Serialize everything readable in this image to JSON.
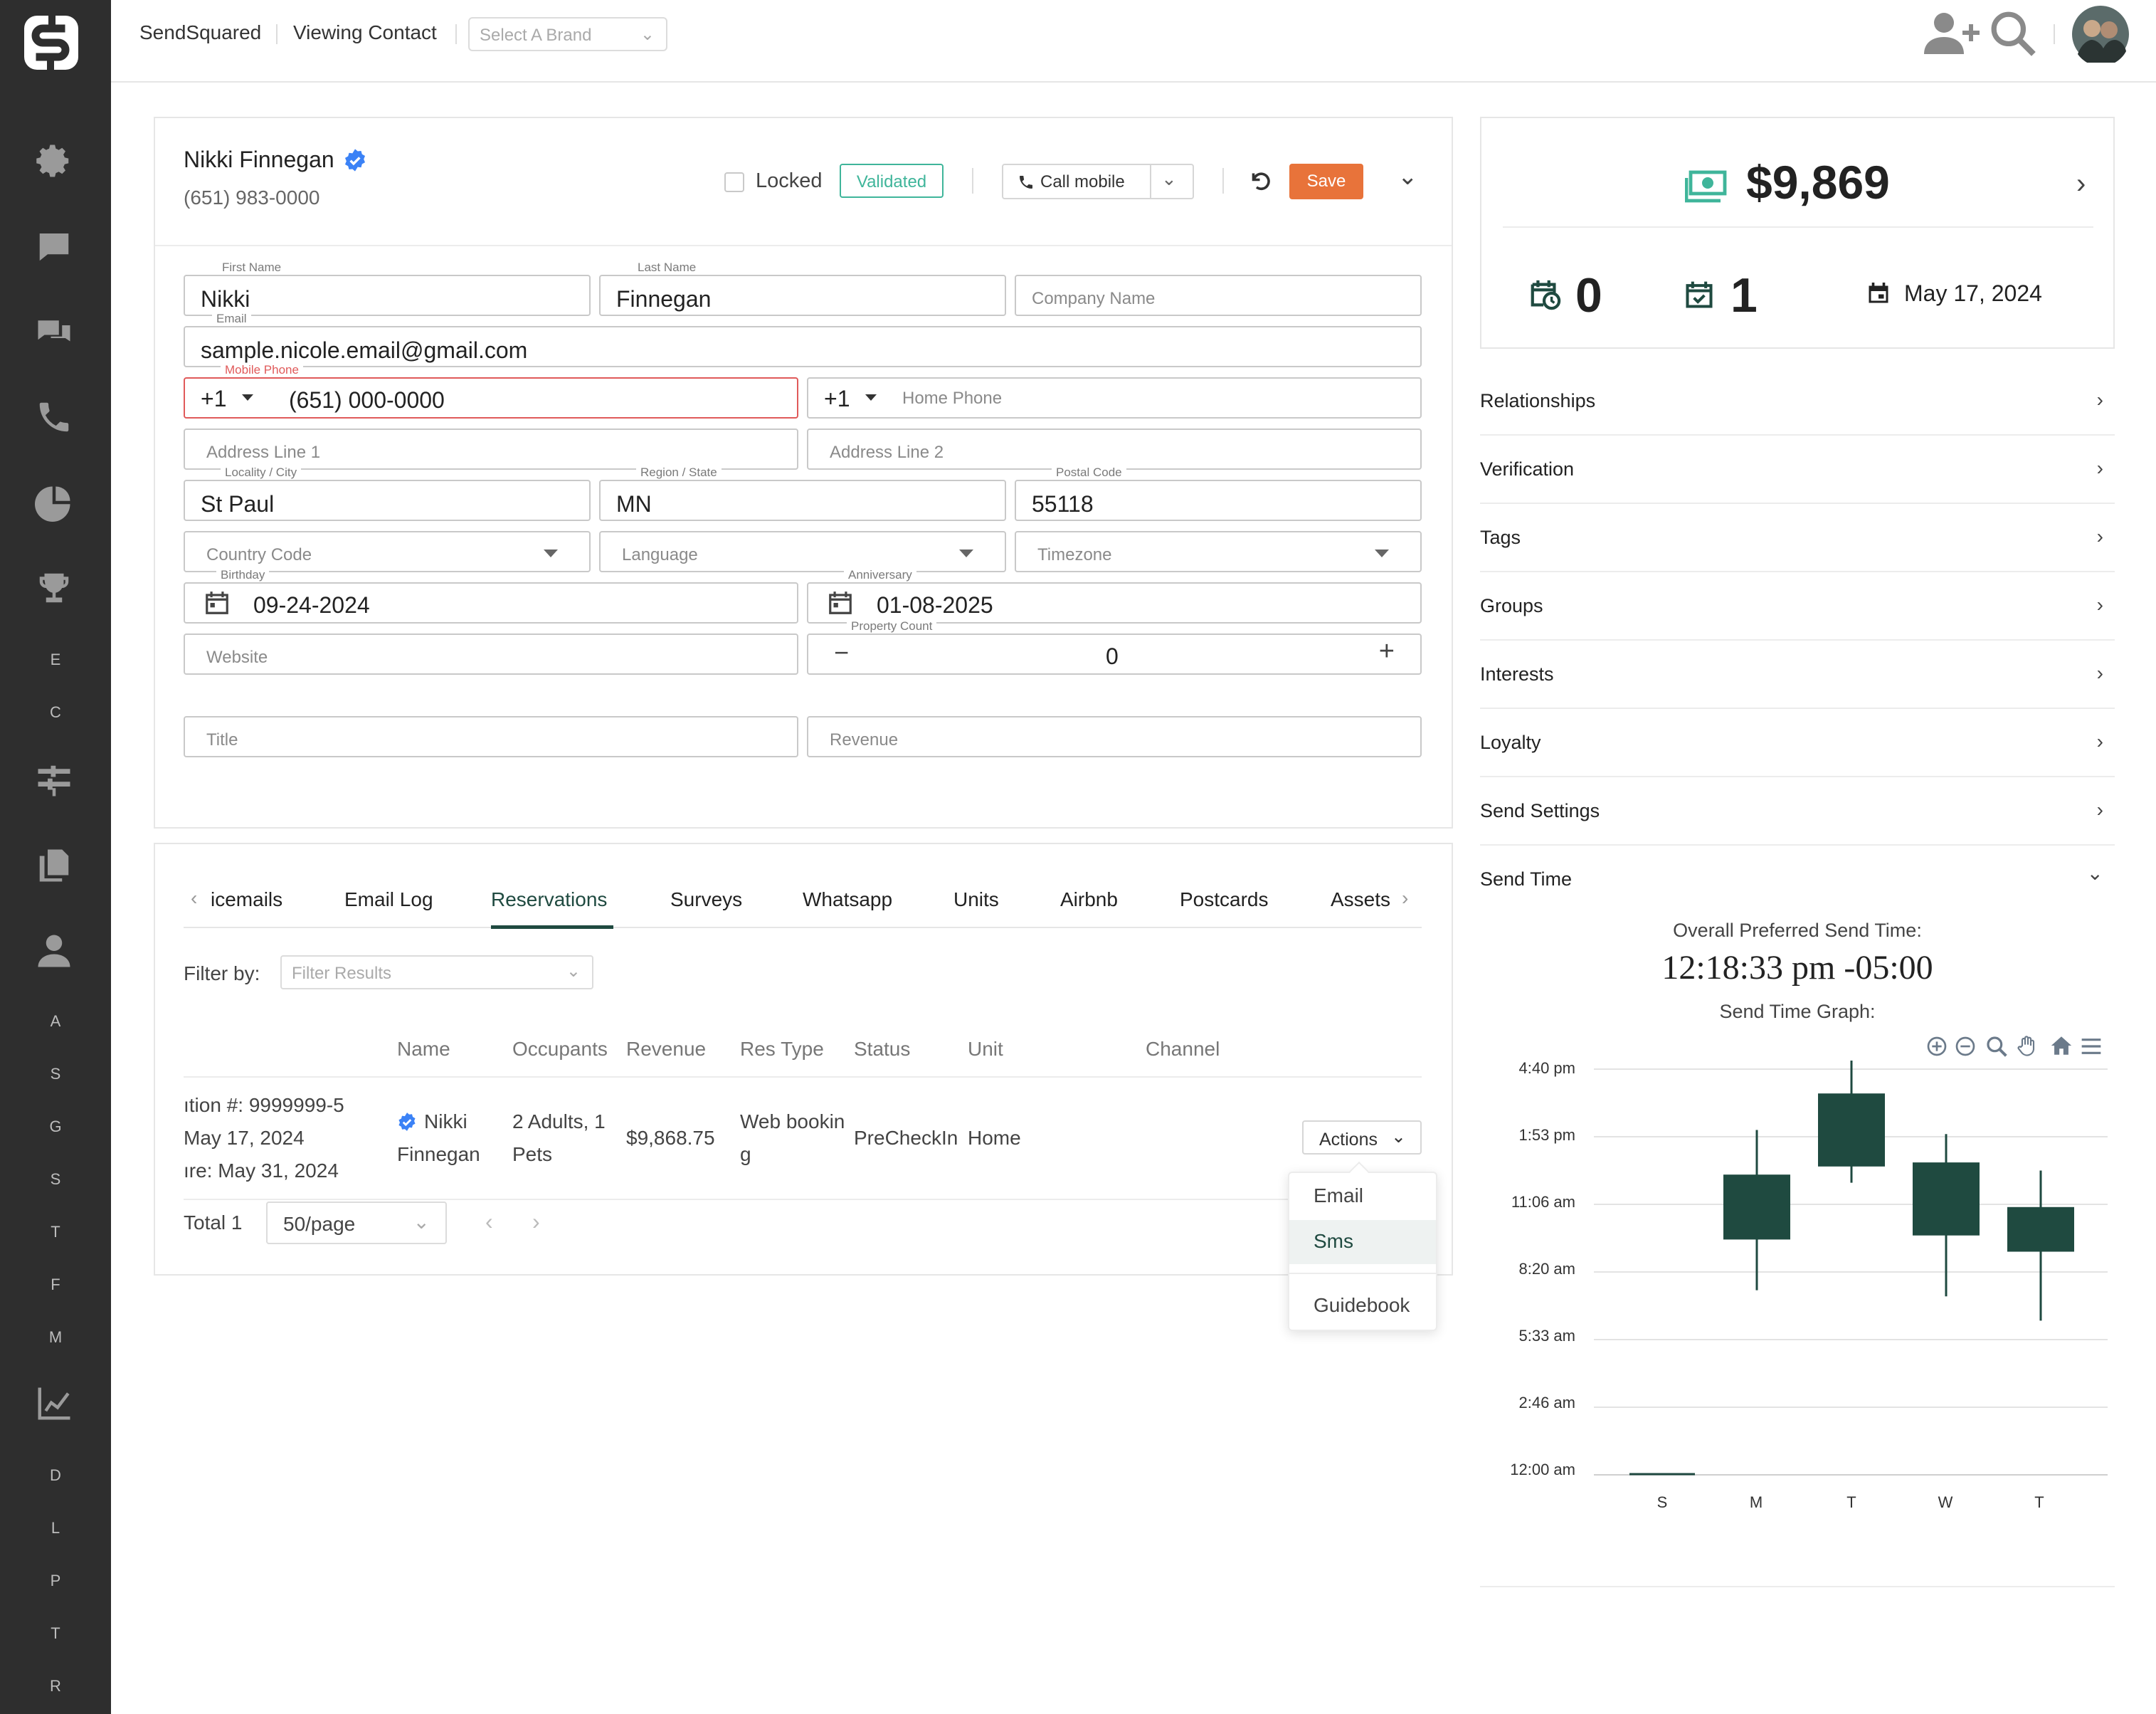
{
  "app": {
    "name": "SendSquared",
    "page": "Viewing Contact",
    "brand_placeholder": "Select A Brand"
  },
  "sidebar": {
    "icons": [
      "settings-icon",
      "chat-bubble-icon",
      "conversations-icon",
      "phone-icon",
      "pie-chart-icon",
      "trophy-icon",
      "sliders-icon",
      "documents-icon",
      "user-icon",
      "line-chart-icon"
    ],
    "letters_a": [
      "E",
      "C"
    ],
    "letters_b": [
      "A",
      "S",
      "G",
      "S",
      "T",
      "F",
      "M"
    ],
    "letters_c": [
      "D",
      "L",
      "P",
      "T",
      "R"
    ]
  },
  "contact": {
    "name": "Nikki Finnegan",
    "phone": "(651) 983-0000",
    "locked_label": "Locked",
    "validated_label": "Validated",
    "call_label": "Call mobile",
    "save_label": "Save"
  },
  "form": {
    "first_name": {
      "label": "First Name",
      "value": "Nikki"
    },
    "last_name": {
      "label": "Last Name",
      "value": "Finnegan"
    },
    "company": {
      "placeholder": "Company Name"
    },
    "email": {
      "label": "Email",
      "value": "sample.nicole.email@gmail.com"
    },
    "mobile": {
      "label": "Mobile Phone",
      "code": "+1",
      "value": "(651) 000-0000"
    },
    "home": {
      "code": "+1",
      "placeholder": "Home Phone"
    },
    "address1": {
      "placeholder": "Address Line 1"
    },
    "address2": {
      "placeholder": "Address Line 2"
    },
    "city": {
      "label": "Locality / City",
      "value": "St Paul"
    },
    "region": {
      "label": "Region / State",
      "value": "MN"
    },
    "postal": {
      "label": "Postal Code",
      "value": "55118"
    },
    "country": {
      "placeholder": "Country Code"
    },
    "language": {
      "placeholder": "Language"
    },
    "timezone": {
      "placeholder": "Timezone"
    },
    "birthday": {
      "label": "Birthday",
      "value": "09-24-2024"
    },
    "anniversary": {
      "label": "Anniversary",
      "value": "01-08-2025"
    },
    "website": {
      "placeholder": "Website"
    },
    "property_count": {
      "label": "Property Count",
      "value": "0",
      "minus": "−",
      "plus": "+"
    },
    "title": {
      "placeholder": "Title"
    },
    "revenue": {
      "placeholder": "Revenue"
    }
  },
  "tabs": {
    "items": [
      "icemails",
      "Email Log",
      "Reservations",
      "Surveys",
      "Whatsapp",
      "Units",
      "Airbnb",
      "Postcards",
      "Assets"
    ],
    "active": "Reservations"
  },
  "filter": {
    "label": "Filter by:",
    "placeholder": "Filter Results"
  },
  "table": {
    "headers": [
      "Name",
      "Occupants",
      "Revenue",
      "Res Type",
      "Status",
      "Unit",
      "Channel"
    ],
    "row": {
      "dates": [
        "ıtion #: 9999999-5",
        "May 17, 2024",
        "ıre: May 31, 2024"
      ],
      "name": [
        "Nikki",
        "Finnegan"
      ],
      "occupants": [
        "2 Adults, 1",
        "Pets"
      ],
      "revenue": "$9,868.75",
      "res_type": [
        "Web bookin",
        "g"
      ],
      "status": "PreCheckIn",
      "unit": "Home",
      "actions_label": "Actions"
    },
    "total": "Total 1",
    "page_size": "50/page"
  },
  "actions_menu": [
    "Email",
    "Sms",
    "Guidebook"
  ],
  "stats": {
    "revenue": "$9,869",
    "upcoming": "0",
    "completed": "1",
    "date": "May 17, 2024"
  },
  "accordion": [
    "Relationships",
    "Verification",
    "Tags",
    "Groups",
    "Interests",
    "Loyalty",
    "Send Settings",
    "Send Time"
  ],
  "send_time": {
    "title": "Overall Preferred Send Time:",
    "value": "12:18:33 pm -05:00",
    "graph_title": "Send Time Graph:"
  },
  "chart_data": {
    "type": "candlestick",
    "categories": [
      "S",
      "M",
      "T",
      "W",
      "T"
    ],
    "y_tick_labels": [
      "12:00 am",
      "2:46 am",
      "5:33 am",
      "8:20 am",
      "11:06 am",
      "1:53 pm",
      "4:40 pm"
    ],
    "y_range_minutes": [
      0,
      1000
    ],
    "candles": [
      {
        "open": 0,
        "close": 0,
        "low": 0,
        "high": 0
      },
      {
        "open": 580,
        "close": 740,
        "low": 455,
        "high": 850
      },
      {
        "open": 760,
        "close": 940,
        "low": 720,
        "high": 1135
      },
      {
        "open": 590,
        "close": 770,
        "low": 440,
        "high": 840
      },
      {
        "open": 550,
        "close": 660,
        "low": 380,
        "high": 750
      }
    ],
    "color": "#1f4a40",
    "grid": true
  },
  "colors": {
    "accent_green": "#1f4a40",
    "save_orange": "#e8733a",
    "validated": "#3fb59a",
    "sidebar": "#2e2e2e",
    "verified_blue": "#3b82f6"
  }
}
